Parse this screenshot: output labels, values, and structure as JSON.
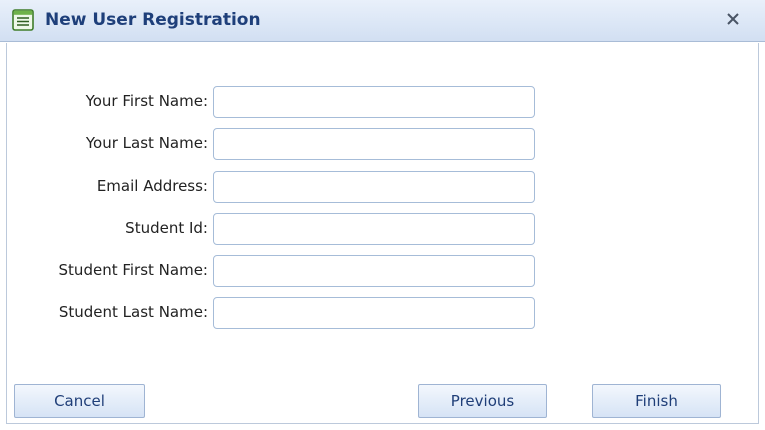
{
  "window": {
    "title": "New User Registration",
    "close_label": "X",
    "title_icon": "form-icon",
    "close_icon": "close-icon"
  },
  "form": {
    "fields": [
      {
        "label": "Your First Name:",
        "value": ""
      },
      {
        "label": "Your Last Name:",
        "value": ""
      },
      {
        "label": "Email Address:",
        "value": ""
      },
      {
        "label": "Student Id:",
        "value": ""
      },
      {
        "label": "Student First Name:",
        "value": ""
      },
      {
        "label": "Student Last Name:",
        "value": ""
      }
    ]
  },
  "buttons": {
    "cancel": "Cancel",
    "previous": "Previous",
    "finish": "Finish"
  },
  "colors": {
    "title_text": "#1e3f7a",
    "titlebar_bg": "#dce7f6",
    "button_text": "#1f3e78",
    "input_border": "#a6bcd8"
  }
}
